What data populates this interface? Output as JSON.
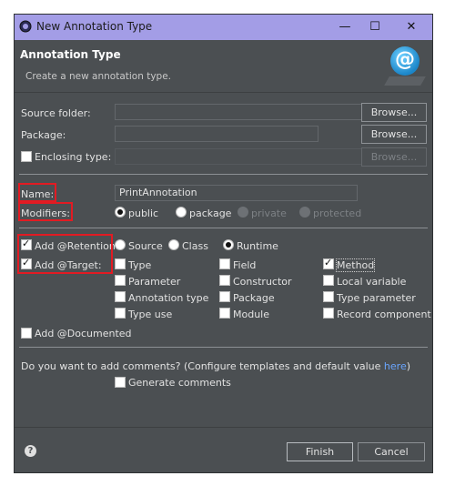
{
  "window": {
    "title": "New Annotation Type",
    "controls": [
      "minimize",
      "maximize",
      "close"
    ]
  },
  "header": {
    "title": "Annotation Type",
    "subtitle": "Create a new annotation type.",
    "badge": "@"
  },
  "source_folder": {
    "label": "Source folder:",
    "value": "",
    "browse": "Browse..."
  },
  "package": {
    "label": "Package:",
    "value": "",
    "browse": "Browse..."
  },
  "enclosing": {
    "label": "Enclosing type:",
    "checked": false,
    "value": "",
    "browse": "Browse..."
  },
  "name": {
    "label": "Name:",
    "value": "PrintAnnotation"
  },
  "modifiers": {
    "label": "Modifiers:",
    "options": [
      "public",
      "package",
      "private",
      "protected"
    ],
    "selected": "public"
  },
  "retention": {
    "label": "Add @Retention:",
    "checked": true,
    "options": [
      "Source",
      "Class",
      "Runtime"
    ],
    "selected": "Runtime"
  },
  "target": {
    "label": "Add @Target:",
    "checked": true,
    "items": [
      {
        "label": "Type",
        "checked": false
      },
      {
        "label": "Field",
        "checked": false
      },
      {
        "label": "Method",
        "checked": true
      },
      {
        "label": "Parameter",
        "checked": false
      },
      {
        "label": "Constructor",
        "checked": false
      },
      {
        "label": "Local variable",
        "checked": false
      },
      {
        "label": "Annotation type",
        "checked": false
      },
      {
        "label": "Package",
        "checked": false
      },
      {
        "label": "Type parameter",
        "checked": false
      },
      {
        "label": "Type use",
        "checked": false
      },
      {
        "label": "Module",
        "checked": false
      },
      {
        "label": "Record component",
        "checked": false
      }
    ]
  },
  "documented": {
    "label": "Add @Documented",
    "checked": false
  },
  "comments": {
    "question": "Do you want to add comments? (Configure templates and default value ",
    "link": "here",
    "question_end": ")",
    "generate_label": "Generate comments",
    "generate_checked": false
  },
  "footer": {
    "finish": "Finish",
    "cancel": "Cancel"
  },
  "colors": {
    "highlight": "#e21b23",
    "titlebar": "#a39de6",
    "dialog_bg": "#4b4f52"
  }
}
